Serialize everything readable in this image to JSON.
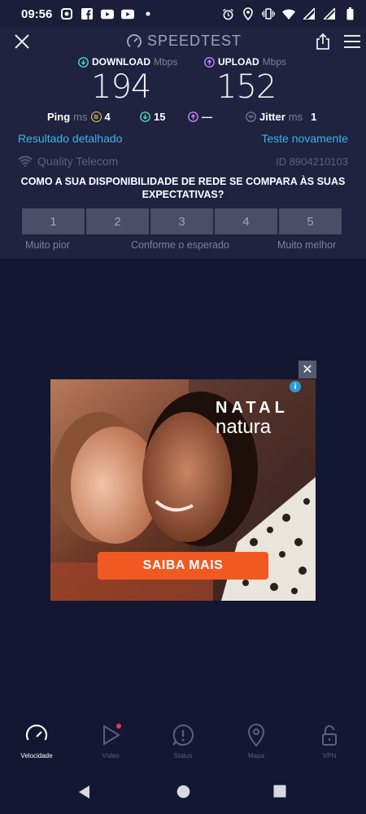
{
  "status_bar": {
    "time": "09:56",
    "left_icons": [
      "record-icon",
      "facebook-icon",
      "youtube-icon",
      "youtube-icon",
      "dot-icon"
    ],
    "right_icons": [
      "alarm-icon",
      "location-icon",
      "vibrate-icon",
      "wifi-icon",
      "signal-icon",
      "signal-icon",
      "battery-icon"
    ]
  },
  "header": {
    "title": "SPEEDTEST"
  },
  "result": {
    "download_label": "DOWNLOAD",
    "download_unit": "Mbps",
    "download_value": "194",
    "upload_label": "UPLOAD",
    "upload_unit": "Mbps",
    "upload_value": "152",
    "ping_label": "Ping",
    "ping_unit": "ms",
    "ping_idle": "4",
    "ping_download": "15",
    "ping_upload": "—",
    "jitter_label": "Jitter",
    "jitter_unit": "ms",
    "jitter_value": "1",
    "detail_link": "Resultado detalhado",
    "retest_link": "Teste novamente",
    "isp": "Quality Telecom",
    "result_id": "ID 8904210103"
  },
  "survey": {
    "question": "COMO A SUA DISPONIBILIDADE DE REDE SE COMPARA ÀS SUAS EXPECTATIVAS?",
    "options": [
      "1",
      "2",
      "3",
      "4",
      "5"
    ],
    "scale_low": "Muito pior",
    "scale_mid": "Conforme o esperado",
    "scale_high": "Muito melhor"
  },
  "ad": {
    "brand_line1": "NATAL",
    "brand_line2": "natura",
    "cta": "SAIBA MAIS",
    "info": "i",
    "close": "✕"
  },
  "bottom_nav": {
    "items": [
      {
        "label": "Velocidade",
        "icon": "speedometer-icon",
        "active": true
      },
      {
        "label": "Vídeo",
        "icon": "play-icon",
        "active": false
      },
      {
        "label": "Status",
        "icon": "alert-icon",
        "active": false
      },
      {
        "label": "Mapa",
        "icon": "map-pin-icon",
        "active": false
      },
      {
        "label": "VPN",
        "icon": "lock-icon",
        "active": false
      }
    ]
  },
  "colors": {
    "background": "#141732",
    "panel": "#1f2340",
    "link": "#3fb2e6",
    "download": "#4fd1c5",
    "upload": "#c084fc",
    "ping": "#f6c945",
    "cta": "#f05a22"
  }
}
